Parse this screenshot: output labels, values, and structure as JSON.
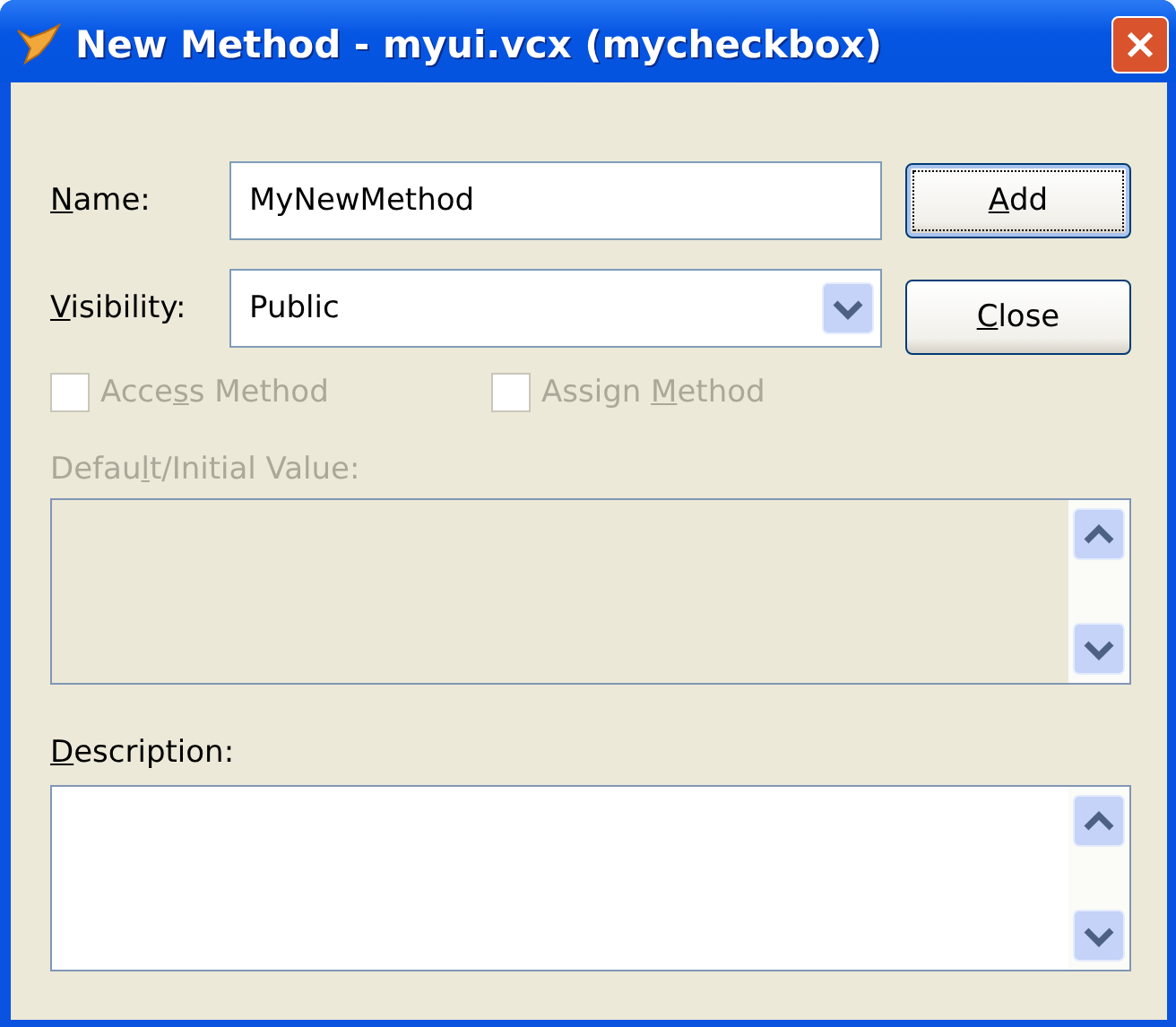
{
  "window": {
    "title": "New Method - myui.vcx (mycheckbox)"
  },
  "name": {
    "label": {
      "key": "N",
      "post": "ame:"
    },
    "value": "MyNewMethod"
  },
  "visibility": {
    "label": {
      "key": "V",
      "post": "isibility:"
    },
    "value": "Public"
  },
  "buttons": [
    {
      "label": {
        "key": "A",
        "post": "dd"
      },
      "default": true
    },
    {
      "label": {
        "key": "C",
        "post": "lose"
      },
      "default": false
    }
  ],
  "checkboxes": [
    {
      "label": {
        "pre": "Acce",
        "key": "s",
        "post": "s Method"
      },
      "checked": false,
      "disabled": true
    },
    {
      "label": {
        "pre": "Assign ",
        "key": "M",
        "post": "ethod"
      },
      "checked": false,
      "disabled": true
    }
  ],
  "default_value": {
    "label": {
      "pre": "Defau",
      "key": "l",
      "post": "t/Initial Value:"
    },
    "disabled": true
  },
  "description": {
    "label": {
      "key": "D",
      "post": "escription:"
    },
    "disabled": false
  }
}
